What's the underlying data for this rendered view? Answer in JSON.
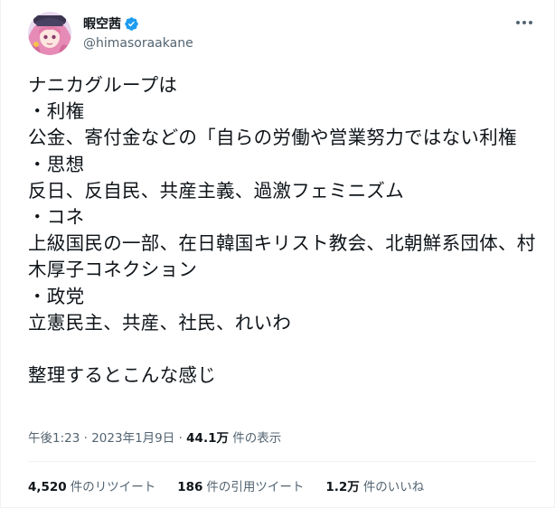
{
  "user": {
    "display_name": "暇空茜",
    "handle": "@himasoraakane",
    "verified_icon": "verified-badge-icon",
    "avatar_icon": "avatar"
  },
  "tweet": {
    "text": "ナニカグループは\n・利権\n公金、寄付金などの「自らの労働や営業努力ではない利権\n・思想\n反日、反自民、共産主義、過激フェミニズム\n・コネ\n上級国民の一部、在日韓国キリスト教会、北朝鮮系団体、村木厚子コネクション\n・政党\n立憲民主、共産、社民、れいわ\n\n整理するとこんな感じ"
  },
  "meta": {
    "time": "午後1:23",
    "sep1": "·",
    "date": "2023年1月9日",
    "sep2": "·",
    "views_count": "44.1万",
    "views_label": "件の表示"
  },
  "stats": {
    "retweets_count": "4,520",
    "retweets_label": "件のリツイート",
    "quotes_count": "186",
    "quotes_label": "件の引用ツイート",
    "likes_count": "1.2万",
    "likes_label": "件のいいね"
  },
  "colors": {
    "text_primary": "#0f1419",
    "text_secondary": "#536471",
    "verified_blue": "#1d9bf0",
    "divider": "#eff3f4"
  }
}
